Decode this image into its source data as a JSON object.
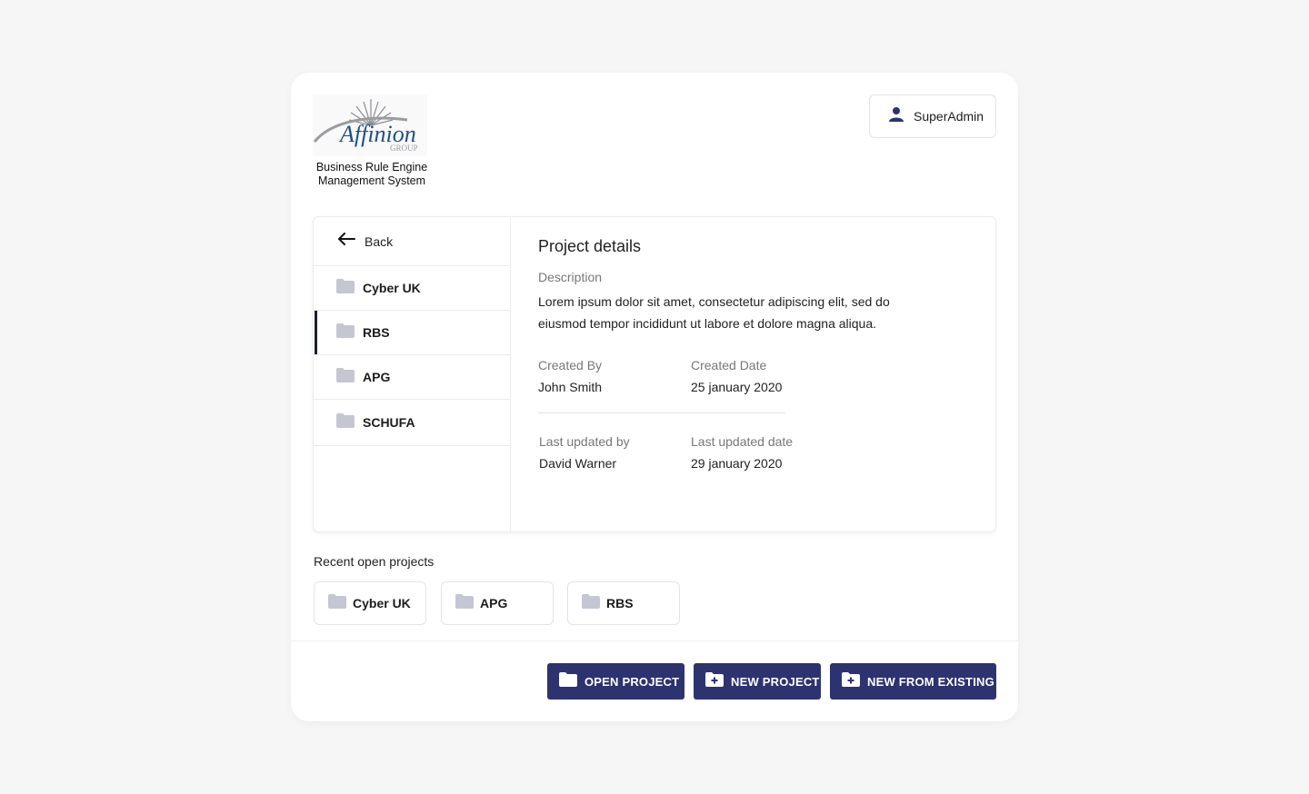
{
  "brand": {
    "logo_text": "Affinion",
    "logo_group": "GROUP",
    "subtitle_line1": "Business Rule Engine",
    "subtitle_line2": "Management System"
  },
  "user": {
    "name": "SuperAdmin",
    "icon": "person-icon"
  },
  "sidebar": {
    "back_label": "Back",
    "items": [
      {
        "label": "Cyber UK",
        "icon": "folder-icon",
        "active": false
      },
      {
        "label": "RBS",
        "icon": "folder-icon",
        "active": true
      },
      {
        "label": "APG",
        "icon": "folder-icon",
        "active": false
      },
      {
        "label": "SCHUFA",
        "icon": "folder-icon",
        "active": false
      }
    ]
  },
  "details": {
    "title": "Project details",
    "description_label": "Description",
    "description": "Lorem ipsum dolor sit amet, consectetur adipiscing elit, sed do eiusmod tempor incididunt ut labore et dolore magna aliqua.",
    "created_by_label": "Created By",
    "created_by": "John Smith",
    "created_date_label": "Created Date",
    "created_date": "25 january 2020",
    "updated_by_label": "Last updated by",
    "updated_by": "David Warner",
    "updated_date_label": "Last updated date",
    "updated_date": "29 january 2020"
  },
  "recent": {
    "title": "Recent open projects",
    "items": [
      {
        "label": "Cyber UK"
      },
      {
        "label": "APG"
      },
      {
        "label": "RBS"
      }
    ]
  },
  "actions": {
    "open_project": "OPEN PROJECT",
    "new_project": "NEW PROJECT",
    "new_from_existing": "NEW FROM EXISTING"
  },
  "colors": {
    "primary": "#2d336f",
    "folder": "#c5c6d4",
    "active_indicator": "#1b1c2e"
  }
}
